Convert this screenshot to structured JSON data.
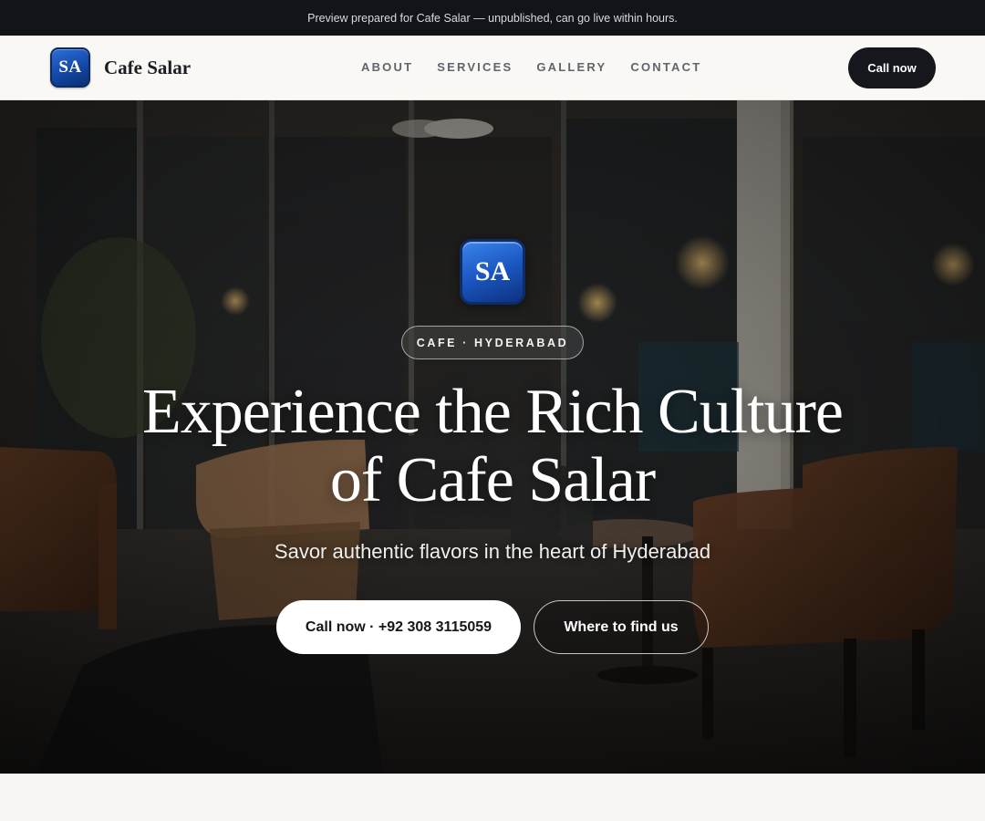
{
  "preview_bar": {
    "text": "Preview prepared for Cafe Salar — unpublished, can go live within hours."
  },
  "nav": {
    "logo_text": "SA",
    "brand_name": "Cafe Salar",
    "links": [
      {
        "label": "ABOUT"
      },
      {
        "label": "SERVICES"
      },
      {
        "label": "GALLERY"
      },
      {
        "label": "CONTACT"
      }
    ],
    "cta_label": "Call now"
  },
  "hero": {
    "logo_text": "SA",
    "tag": "CAFE · HYDERABAD",
    "title_line1": "Experience the Rich Culture",
    "title_line2": "of Cafe Salar",
    "subtitle": "Savor authentic flavors in the heart of Hyderabad",
    "primary_button": "Call now · +92 308 3115059",
    "secondary_button": "Where to find us"
  },
  "colors": {
    "preview_bar_bg": "#121419",
    "dark_button": "#15171c",
    "logo_blue": "#1b56c2",
    "page_bg": "#f8f7f4"
  }
}
